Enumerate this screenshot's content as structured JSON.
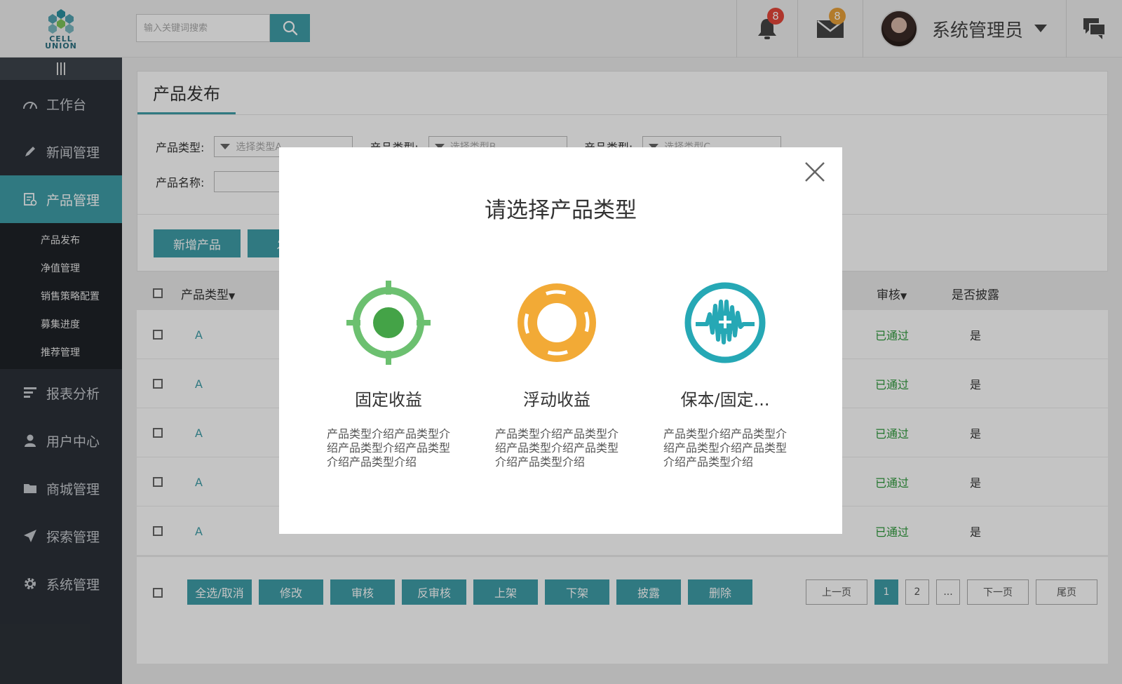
{
  "brand": {
    "name_line1": "CELL",
    "name_line2": "UNION"
  },
  "search": {
    "placeholder": "输入关键词搜索"
  },
  "header": {
    "notification_count": "8",
    "message_count": "8",
    "user_name": "系统管理员"
  },
  "sidebar": {
    "items": [
      {
        "label": "工作台"
      },
      {
        "label": "新闻管理"
      },
      {
        "label": "产品管理"
      },
      {
        "label": "报表分析"
      },
      {
        "label": "用户中心"
      },
      {
        "label": "商城管理"
      },
      {
        "label": "探索管理"
      },
      {
        "label": "系统管理"
      }
    ],
    "submenu": [
      "产品发布",
      "净值管理",
      "销售策略配置",
      "募集进度",
      "推荐管理"
    ]
  },
  "page": {
    "tab": "产品发布",
    "filter": {
      "type_label": "产品类型:",
      "type_a": "选择类型A",
      "type_b": "选择类型B",
      "type_c": "选择类型C",
      "name_label": "产品名称:"
    },
    "add_button": "新增产品",
    "second_button_partial": "发"
  },
  "table": {
    "headers": {
      "type": "产品类型",
      "audit": "审核",
      "disclose": "是否披露"
    },
    "rows": [
      {
        "type": "A",
        "audit": "已通过",
        "disclose": "是"
      },
      {
        "type": "A",
        "audit": "已通过",
        "disclose": "是"
      },
      {
        "type": "A",
        "audit": "已通过",
        "disclose": "是"
      },
      {
        "type": "A",
        "audit": "已通过",
        "disclose": "是"
      },
      {
        "type": "A",
        "audit": "已通过",
        "disclose": "是"
      }
    ]
  },
  "actions": [
    "全选/取消",
    "修改",
    "审核",
    "反审核",
    "上架",
    "下架",
    "披露",
    "删除"
  ],
  "pagination": {
    "prev": "上一页",
    "p1": "1",
    "p2": "2",
    "ellipsis": "...",
    "next": "下一页",
    "last": "尾页"
  },
  "modal": {
    "title": "请选择产品类型",
    "options": [
      {
        "name": "固定收益",
        "desc": "产品类型介绍产品类型介绍产品类型介绍产品类型介绍产品类型介绍",
        "icon": "target-icon",
        "color": "#6cc070"
      },
      {
        "name": "浮动收益",
        "desc": "产品类型介绍产品类型介绍产品类型介绍产品类型介绍产品类型介绍",
        "icon": "lifebuoy-icon",
        "color": "#f2aa36"
      },
      {
        "name": "保本/固定...",
        "desc": "产品类型介绍产品类型介绍产品类型介绍产品类型介绍产品类型介绍",
        "icon": "pulse-shield-icon",
        "color": "#26a8b5"
      }
    ]
  },
  "colors": {
    "accent": "#3f9ea8",
    "sidebar": "#2c3138",
    "success": "#2e9a3c"
  }
}
